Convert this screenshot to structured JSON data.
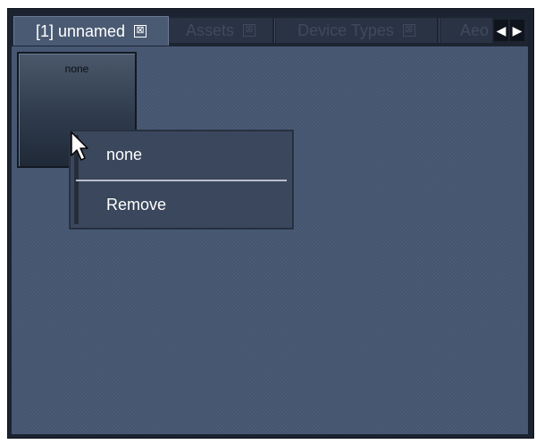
{
  "tabs": [
    {
      "label": "[1] unnamed",
      "close": "⊠",
      "active": true
    },
    {
      "label": "Assets",
      "close": "⊠",
      "active": false
    },
    {
      "label": "Device Types",
      "close": "⊠",
      "active": false
    },
    {
      "label": "Aeo",
      "close": "",
      "active": false
    }
  ],
  "scroll": {
    "left": "◀",
    "right": "▶"
  },
  "tile": {
    "label": "none"
  },
  "context_menu": {
    "items": [
      "none",
      "Remove"
    ]
  },
  "colors": {
    "canvas": "#445570",
    "frame": "#1c2330",
    "tab_active": "#4a5a73",
    "menu_bg": "#3a475c"
  }
}
